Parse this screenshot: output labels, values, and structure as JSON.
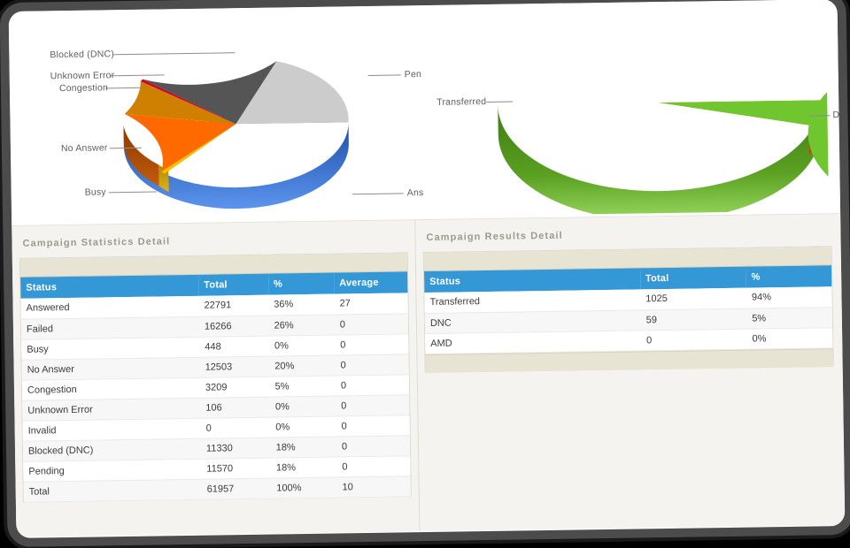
{
  "charts": {
    "left": {
      "labels": [
        {
          "text": "Blocked (DNC)"
        },
        {
          "text": "Unknown Error"
        },
        {
          "text": "Congestion"
        },
        {
          "text": "No Answer"
        },
        {
          "text": "Busy"
        },
        {
          "text": "Pen"
        },
        {
          "text": "Ans"
        }
      ]
    },
    "right": {
      "labels": [
        {
          "text": "Transferred"
        },
        {
          "text": "DNC"
        }
      ]
    }
  },
  "chart_data": [
    {
      "type": "pie",
      "title": "Campaign Statistics",
      "three_d": true,
      "labels": [
        "Ans",
        "Busy",
        "No Answer",
        "Congestion",
        "Unknown Error",
        "Blocked (DNC)",
        "Pen"
      ],
      "full_labels": [
        "Answered",
        "Busy",
        "No Answer",
        "Congestion",
        "Unknown Error",
        "Blocked (DNC)",
        "Pending"
      ],
      "values": [
        22791,
        448,
        12503,
        3209,
        106,
        11330,
        11570
      ],
      "percents": [
        36,
        0.7,
        20,
        5,
        0.2,
        18,
        18
      ],
      "colors": [
        "#3b82e8",
        "#f6c000",
        "#ff6a00",
        "#cf8000",
        "#d00030",
        "#555555",
        "#cccccc"
      ],
      "legend": "none"
    },
    {
      "type": "pie",
      "title": "Campaign Results",
      "three_d": true,
      "labels": [
        "Transferred",
        "DNC"
      ],
      "values": [
        1025,
        59
      ],
      "percents": [
        94,
        5
      ],
      "colors": [
        "#70c62e",
        "#ff5a00"
      ],
      "legend": "none"
    }
  ],
  "panels": {
    "left": {
      "title": "Campaign Statistics Detail",
      "columns": [
        "Status",
        "Total",
        "%",
        "Average"
      ],
      "rows": [
        {
          "status": "Answered",
          "total": "22791",
          "pct": "36%",
          "avg": "27",
          "indent": false
        },
        {
          "status": "Failed",
          "total": "16266",
          "pct": "26%",
          "avg": "0",
          "indent": false
        },
        {
          "status": "Busy",
          "total": "448",
          "pct": "0%",
          "avg": "0",
          "indent": true
        },
        {
          "status": "No Answer",
          "total": "12503",
          "pct": "20%",
          "avg": "0",
          "indent": true
        },
        {
          "status": "Congestion",
          "total": "3209",
          "pct": "5%",
          "avg": "0",
          "indent": true
        },
        {
          "status": "Unknown Error",
          "total": "106",
          "pct": "0%",
          "avg": "0",
          "indent": true
        },
        {
          "status": "Invalid",
          "total": "0",
          "pct": "0%",
          "avg": "0",
          "indent": false
        },
        {
          "status": "Blocked (DNC)",
          "total": "11330",
          "pct": "18%",
          "avg": "0",
          "indent": false
        },
        {
          "status": "Pending",
          "total": "11570",
          "pct": "18%",
          "avg": "0",
          "indent": false
        },
        {
          "status": "Total",
          "total": "61957",
          "pct": "100%",
          "avg": "10",
          "indent": false
        }
      ]
    },
    "right": {
      "title": "Campaign Results Detail",
      "columns": [
        "Status",
        "Total",
        "%"
      ],
      "rows": [
        {
          "status": "Transferred",
          "total": "1025",
          "pct": "94%"
        },
        {
          "status": "DNC",
          "total": "59",
          "pct": "5%"
        },
        {
          "status": "AMD",
          "total": "0",
          "pct": "0%"
        }
      ]
    }
  },
  "theme": {
    "header_blue": "#3498d6",
    "toolbar_cream": "#e8e4d4",
    "panel_bg": "#f5f3ef",
    "link_blue": "#4aa3df",
    "title_gray": "#9a9a92"
  }
}
